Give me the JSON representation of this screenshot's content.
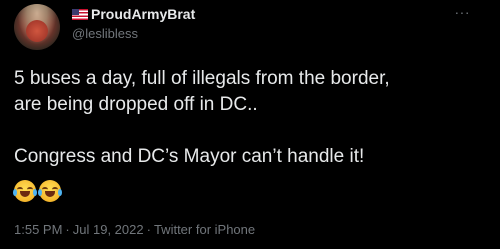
{
  "user": {
    "flag_icon": "us-flag-emoji",
    "display_name": "ProudArmyBrat",
    "handle": "@leslibless"
  },
  "menu": {
    "more_label": "···"
  },
  "tweet": {
    "line1": "5 buses a day, full of illegals from the border,",
    "line2": "are being dropped off in DC..",
    "line3": "Congress and DC’s Mayor can’t handle it!",
    "emojis": [
      "face-with-tears-of-joy",
      "face-with-tears-of-joy"
    ]
  },
  "meta": {
    "time": "1:55 PM",
    "date": "Jul 19, 2022",
    "source": "Twitter for iPhone",
    "separator": "·"
  },
  "colors": {
    "background": "#000000",
    "text": "#e7e9ea",
    "secondary": "#71767b"
  }
}
